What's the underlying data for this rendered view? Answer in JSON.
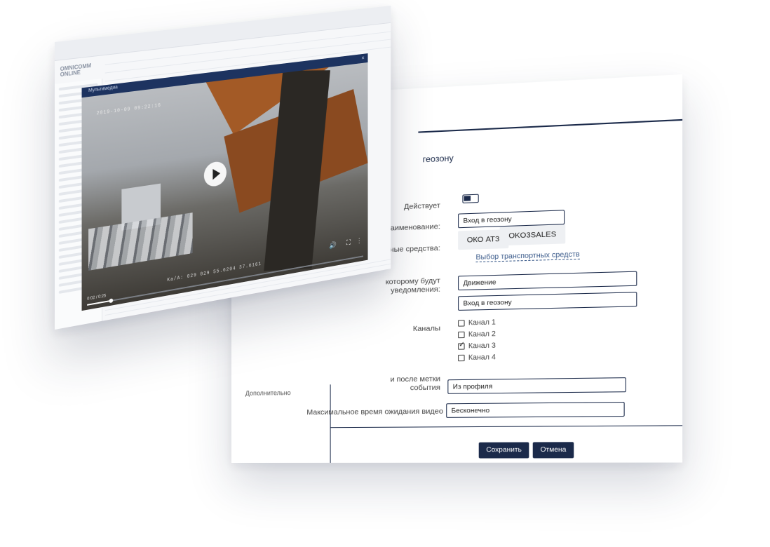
{
  "form": {
    "title": "геозону",
    "labels": {
      "active": "Действует",
      "name": "Наименование:",
      "vehicles": "тные средства:",
      "notify": "которому будут\nуведомления:",
      "channels": "Каналы",
      "before_after": "и после метки\nсобытия",
      "max_wait": "Максимальное время ожидания видео",
      "additional": "Дополнительно"
    },
    "name_value": "Вход в геозону",
    "vehicles": [
      "ОКО АТ3",
      "OKO3SALES"
    ],
    "select_vehicles_link": "Выбор транспортных средств",
    "notify_value_1": "Движение",
    "notify_value_2": "Вход в геозону",
    "channels": [
      {
        "label": "Канал 1",
        "checked": false
      },
      {
        "label": "Канал 2",
        "checked": false
      },
      {
        "label": "Канал 3",
        "checked": true
      },
      {
        "label": "Канал 4",
        "checked": false
      }
    ],
    "before_after_value": "Из профиля",
    "max_wait_value": "Бесконечно",
    "save_label": "Сохранить",
    "cancel_label": "Отмена"
  },
  "app": {
    "logo_line1": "OMNICOMM",
    "logo_line2": "ONLINE",
    "modal_title": "Мультимедиа",
    "video": {
      "timestamp": "2019-10-09 09:22:16",
      "coords": "Ка/А: 029 029 55.6204 37.6161",
      "time": "0:02 / 0:25",
      "progress": 0.08
    }
  }
}
